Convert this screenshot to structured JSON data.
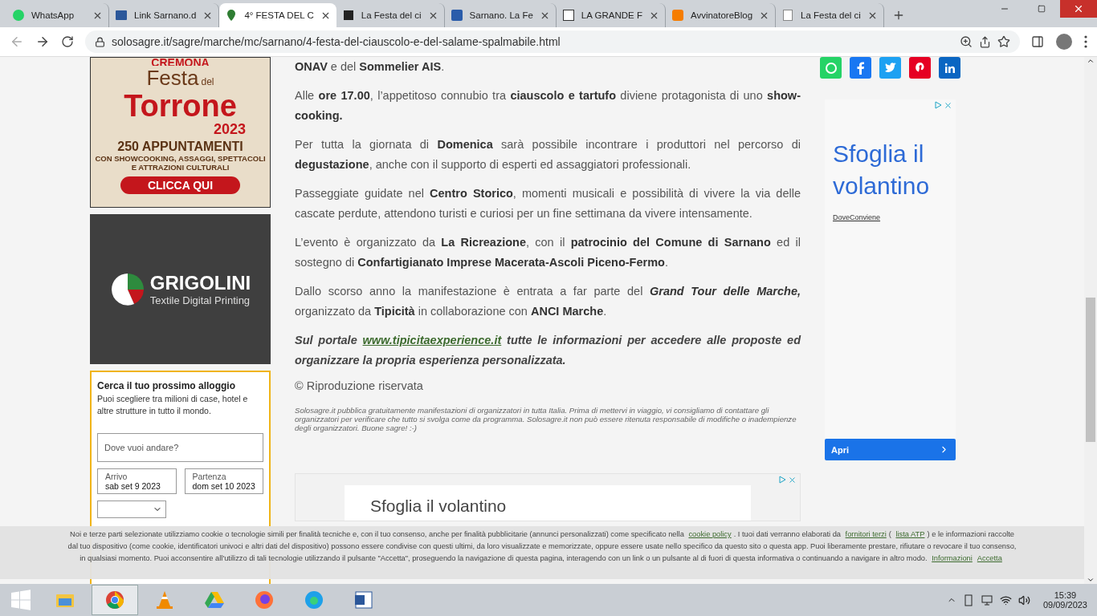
{
  "browser": {
    "tabs": [
      {
        "title": "WhatsApp",
        "selected": false
      },
      {
        "title": "Link Sarnano.d",
        "selected": false
      },
      {
        "title": "4° FESTA DEL C",
        "selected": true
      },
      {
        "title": "La Festa del ci",
        "selected": false
      },
      {
        "title": "Sarnano. La Fe",
        "selected": false
      },
      {
        "title": "LA GRANDE F",
        "selected": false
      },
      {
        "title": "AvvinatoreBlog",
        "selected": false
      },
      {
        "title": "La Festa del ci",
        "selected": false
      }
    ],
    "url": "solosagre.it/sagre/marche/mc/sarnano/4-festa-del-ciauscolo-e-del-salame-spalmabile.html"
  },
  "left_ads": {
    "torrone": {
      "city": "CREMONA",
      "festa": "Festa",
      "del": "del",
      "torrone": "Torrone",
      "year": "2023",
      "headline": "250 APPUNTAMENTI",
      "sub": "CON SHOWCOOKING, ASSAGGI, SPETTACOLI E ATTRAZIONI CULTURALI",
      "cta": "CLICCA QUI"
    },
    "grigolini": {
      "brand": "GRIGOLINI",
      "tagline": "Textile Digital Printing"
    }
  },
  "booking": {
    "title": "Cerca il tuo prossimo alloggio",
    "description": "Puoi scegliere tra milioni di case, hotel e altre strutture in tutto il mondo.",
    "destination_placeholder": "Dove vuoi andare?",
    "arrival_label": "Arrivo",
    "arrival_value": "sab set 9 2023",
    "departure_label": "Partenza",
    "departure_value": "dom set 10 2023"
  },
  "article": {
    "paragraphs": [
      "**ONAV** e del **Sommelier AIS**.",
      "Alle **ore 17.00**, l’appetitoso connubio tra **ciauscolo e tartufo** diviene protagonista di uno **show-cooking.**",
      "Per tutta la giornata di **Domenica** sarà possibile incontrare i produttori nel percorso di **degustazione**, anche con il supporto di esperti ed assaggiatori professionali.",
      "Passeggiate guidate nel **Centro Storico**, momenti musicali e possibilità di vivere la via delle cascate perdute, attendono turisti e curiosi per un fine settimana da vivere intensamente.",
      "L’evento è organizzato da **La Ricreazione**, con il **patrocinio del Comune di Sarnano** ed il sostegno di **Confartigianato Imprese Macerata-Ascoli Piceno-Fermo**.",
      "Dallo scorso anno la manifestazione è entrata a far parte del *Grand Tour delle Marche,* organizzato da **Tipicità** in collaborazione con **ANCI Marche**."
    ],
    "portal": {
      "before": "Sul portale",
      "link": "www.tipicitaexperience.it",
      "after": "tutte le informazioni per accedere alle proposte ed organizzare la propria esperienza personalizzata."
    },
    "copyright": "© Riproduzione riservata",
    "disclaimer": "Solosagre.it pubblica gratuitamente manifestazioni di organizzatori in tutta Italia. Prima di mettervi in viaggio, vi consigliamo di contattare gli organizzatori per verificare che tutto si svolga come da programma. Solosagre.it non può essere ritenuta responsabile di modifiche o inadempienze degli organizzatori. Buone sagre! :-)"
  },
  "side_ad": {
    "headline": "Sfoglia il volantino",
    "advertiser": "DoveConviene",
    "button": "Apri"
  },
  "bottom_ad": {
    "headline": "Sfoglia il volantino"
  },
  "cookie_banner": {
    "parts": [
      {
        "kind": "text",
        "text": "Noi e terze parti selezionate utilizziamo cookie o tecnologie simili per finalità tecniche e, con il tuo consenso, anche per finalità pubblicitarie (annunci personalizzati) come specificato nella"
      },
      {
        "kind": "link",
        "text": "cookie policy"
      },
      {
        "kind": "text",
        "text": ". I tuoi dati verranno elaborati da"
      },
      {
        "kind": "link",
        "text": "fornitori terzi"
      },
      {
        "kind": "text",
        "text": "("
      },
      {
        "kind": "link",
        "text": "lista ATP"
      },
      {
        "kind": "text",
        "text": ") e le informazioni raccolte dal tuo dispositivo (come cookie, identificatori univoci e altri dati del dispositivo) possono essere condivise con questi ultimi, da loro visualizzate e memorizzate, oppure essere usate nello specifico da questo sito o questa app. Puoi liberamente prestare, rifiutare o revocare il tuo consenso, in qualsiasi momento. Puoi acconsentire all'utilizzo di tali tecnologie utilizzando il pulsante \"Accetta\", proseguendo la navigazione di questa pagina, interagendo con un link o un pulsante al di fuori di questa informativa o continuando a navigare in altro modo."
      },
      {
        "kind": "link",
        "text": "Informazioni"
      },
      {
        "kind": "link",
        "text": "Accetta"
      }
    ]
  },
  "taskbar": {
    "apps": [
      {
        "selected": false
      },
      {
        "selected": true
      },
      {
        "selected": false
      },
      {
        "selected": false
      },
      {
        "selected": false
      },
      {
        "selected": false
      },
      {
        "selected": false
      }
    ],
    "time": "15:39",
    "date": "09/09/2023"
  }
}
